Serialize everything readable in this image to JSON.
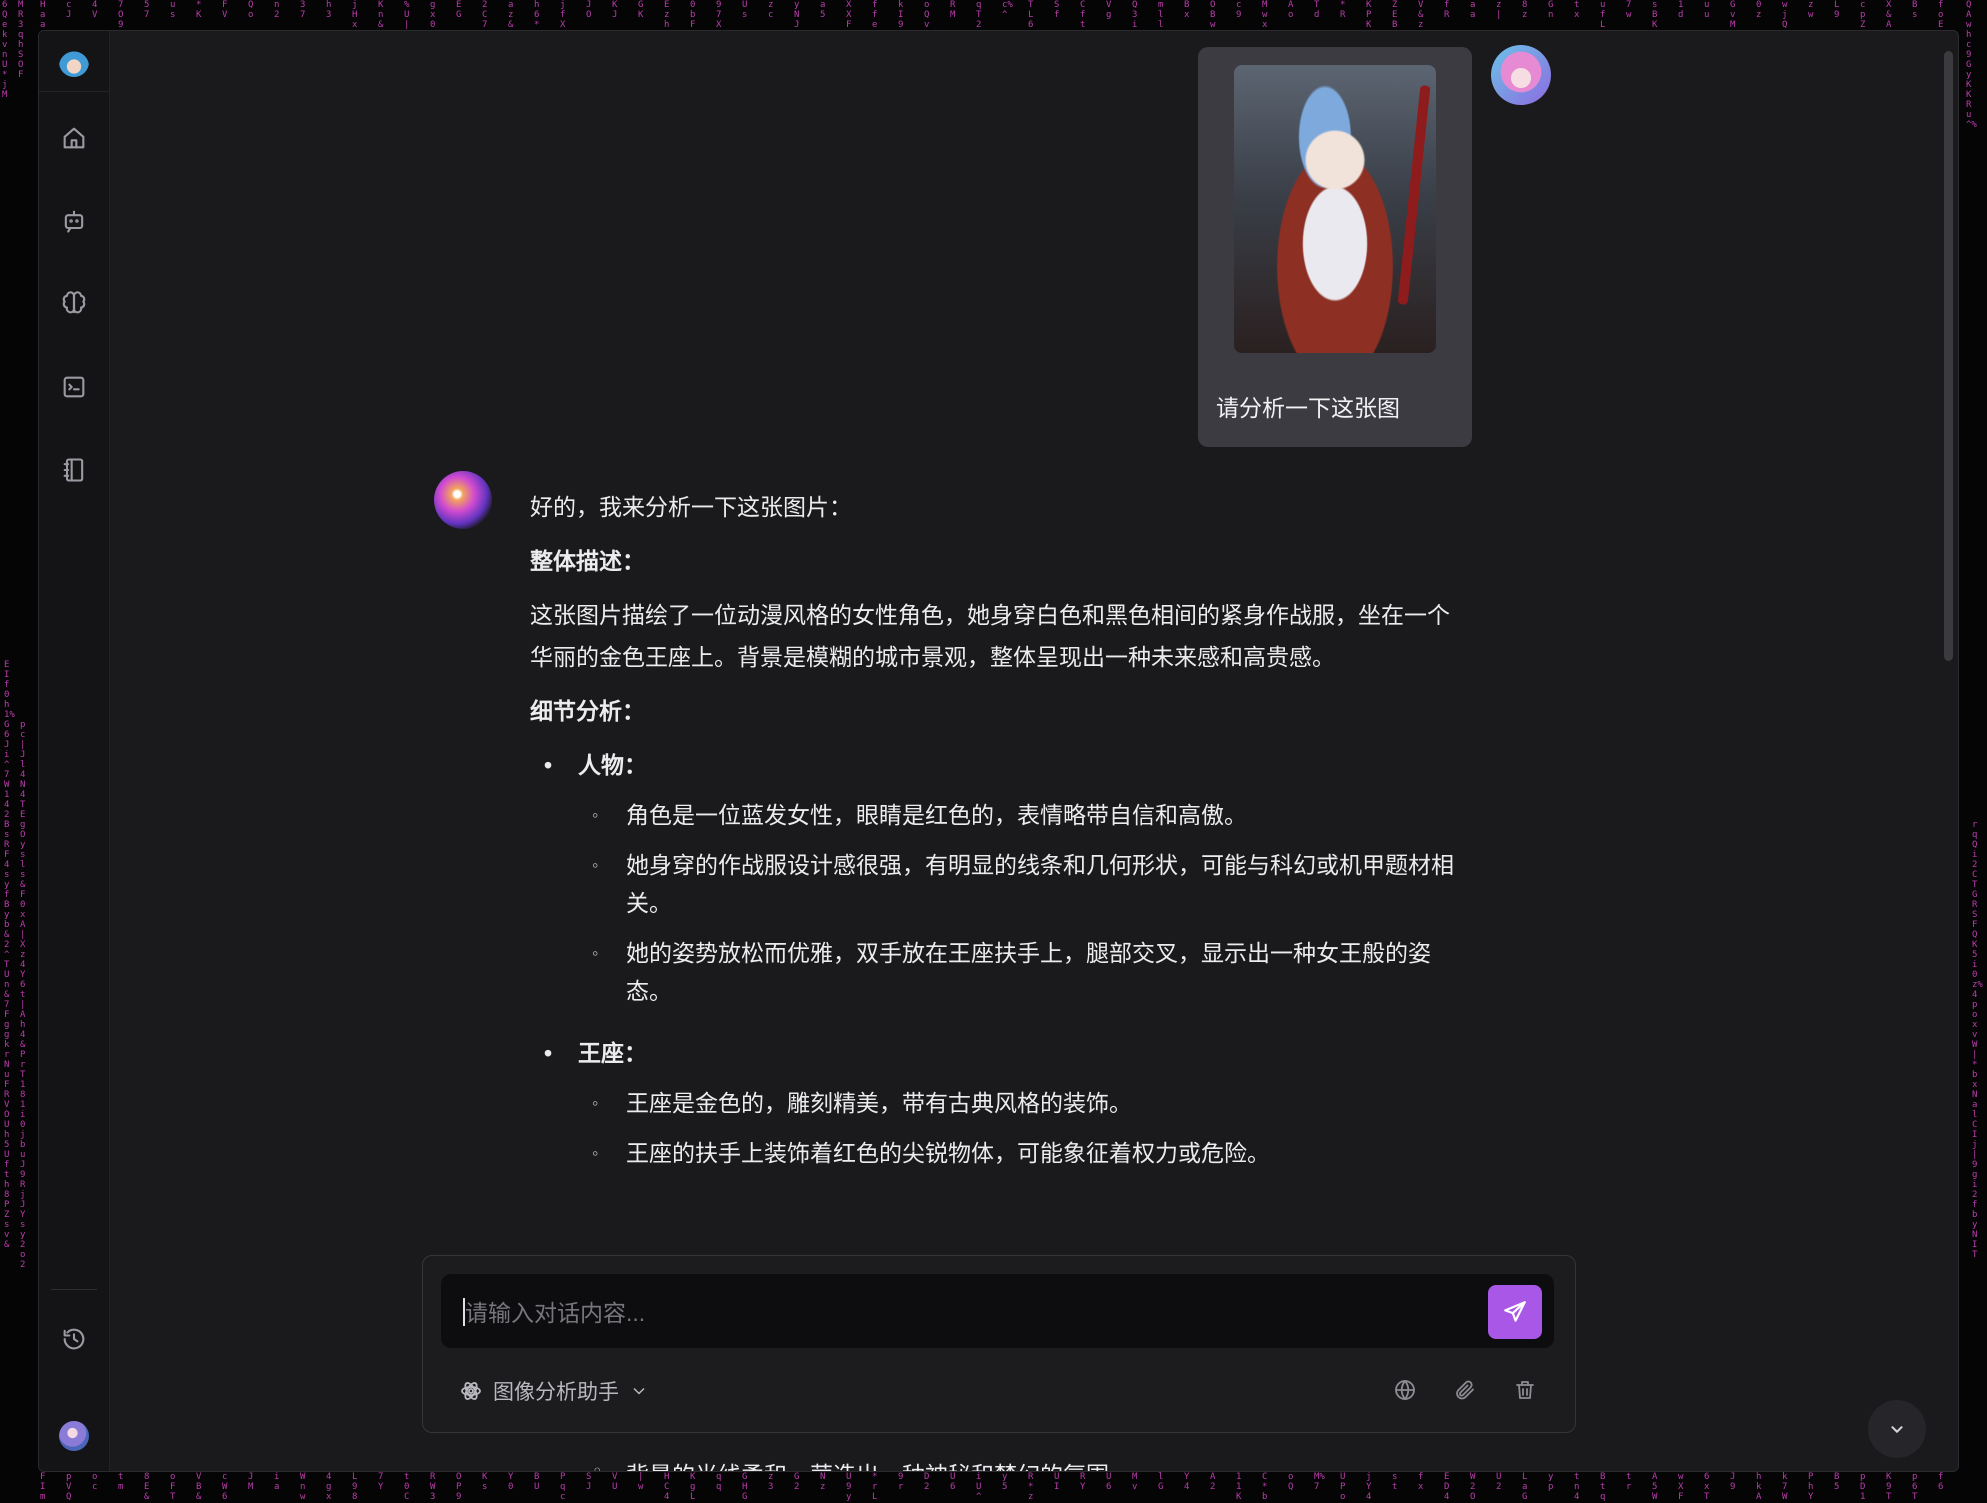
{
  "matrix_color": "#d846c8",
  "accent_color": "#a857e6",
  "sidebar": {
    "logo_icon": "app-logo",
    "items": [
      {
        "name": "home",
        "icon": "home-icon"
      },
      {
        "name": "chat",
        "icon": "bot-icon"
      },
      {
        "name": "brain",
        "icon": "brain-icon"
      },
      {
        "name": "terminal",
        "icon": "terminal-icon"
      },
      {
        "name": "notebook",
        "icon": "notebook-icon"
      }
    ],
    "bottom": [
      {
        "name": "history",
        "icon": "history-icon"
      },
      {
        "name": "avatar",
        "icon": "user-avatar"
      }
    ]
  },
  "chat": {
    "user_message": {
      "text": "请分析一下这张图",
      "image_icon": "uploaded-image-thumbnail"
    },
    "assistant_message": {
      "intro": "好的，我来分析一下这张图片：",
      "heading_overall": "整体描述：",
      "overall_text": "这张图片描绘了一位动漫风格的女性角色，她身穿白色和黑色相间的紧身作战服，坐在一个华丽的金色王座上。背景是模糊的城市景观，整体呈现出一种未来感和高贵感。",
      "heading_detail": "细节分析：",
      "sections": [
        {
          "title": "人物：",
          "items": [
            "角色是一位蓝发女性，眼睛是红色的，表情略带自信和高傲。",
            "她身穿的作战服设计感很强，有明显的线条和几何形状，可能与科幻或机甲题材相关。",
            "她的姿势放松而优雅，双手放在王座扶手上，腿部交叉，显示出一种女王般的姿态。"
          ]
        },
        {
          "title": "王座：",
          "items": [
            "王座是金色的，雕刻精美，带有古典风格的装饰。",
            "王座的扶手上装饰着红色的尖锐物体，可能象征着权力或危险。"
          ]
        }
      ],
      "tail_item": "背景的光线柔和，营造出一种神秘和梦幻的氛围。"
    }
  },
  "composer": {
    "placeholder": "请输入对话内容...",
    "agent_name": "图像分析助手",
    "tools": [
      "globe-icon",
      "paperclip-icon",
      "trash-icon"
    ],
    "send_icon": "send-icon"
  },
  "scroll_button_icon": "chevron-down-icon"
}
